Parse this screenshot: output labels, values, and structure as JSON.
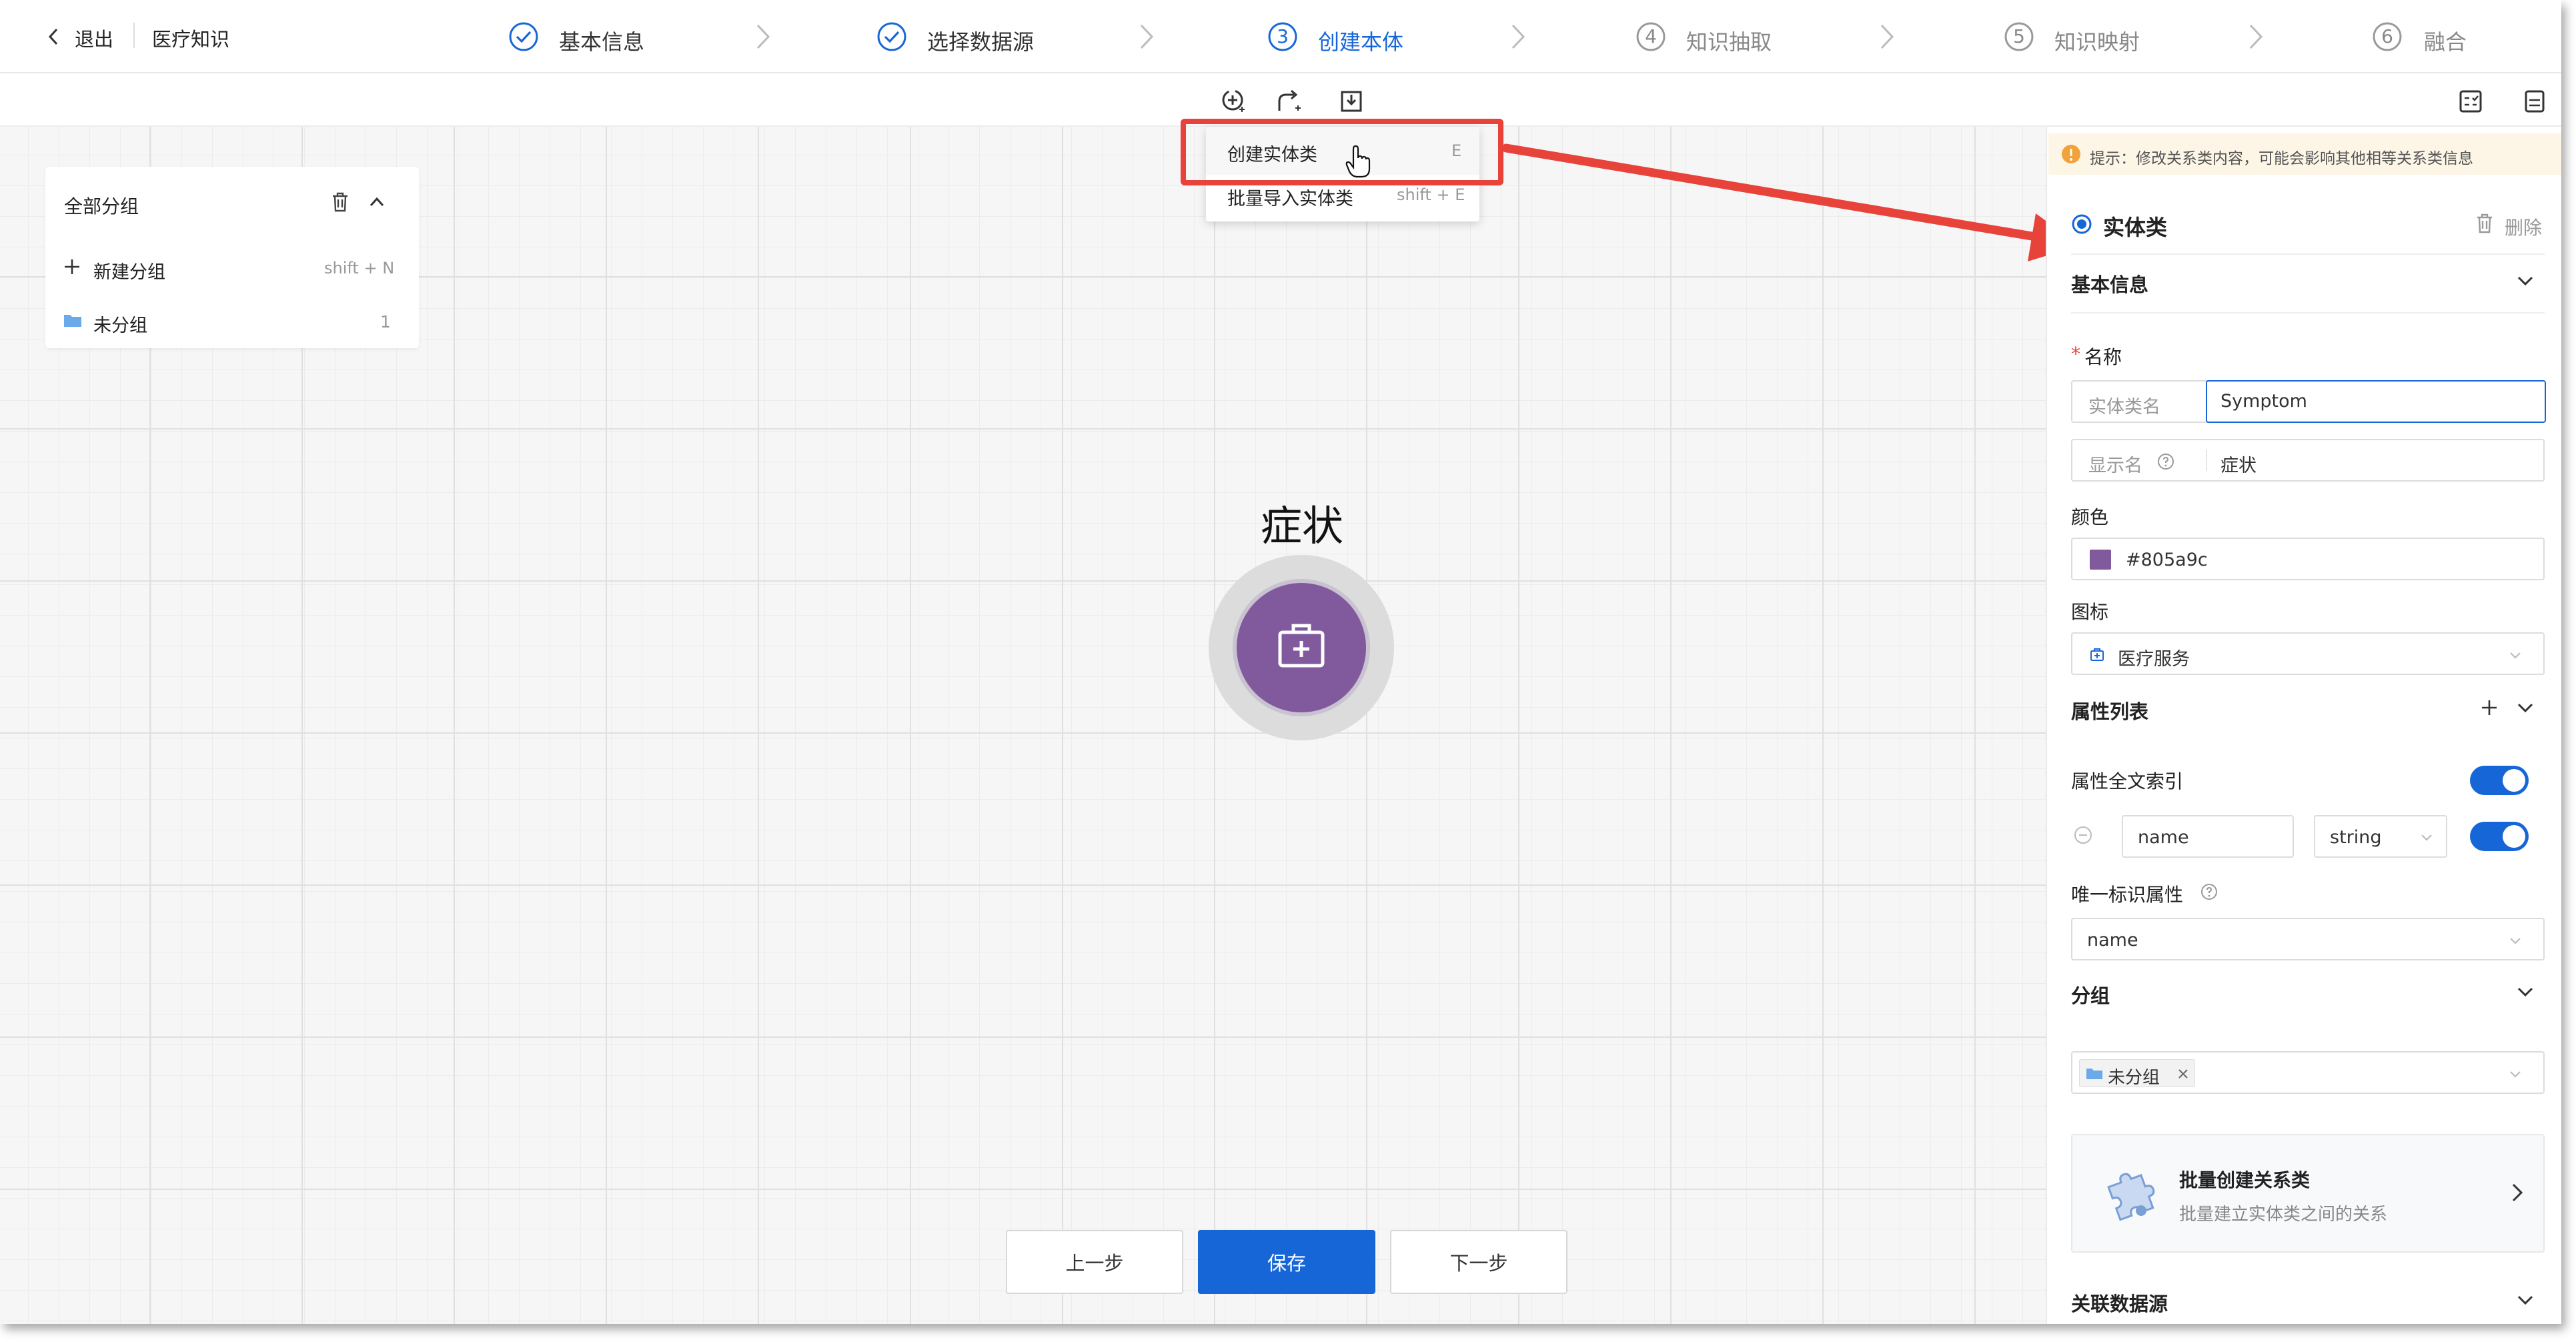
{
  "header": {
    "back_label": "退出",
    "project_name": "医疗知识"
  },
  "steps": [
    {
      "index": "",
      "label": "基本信息",
      "state": "done"
    },
    {
      "index": "",
      "label": "选择数据源",
      "state": "done"
    },
    {
      "index": "3",
      "label": "创建本体",
      "state": "active"
    },
    {
      "index": "4",
      "label": "知识抽取",
      "state": "pending"
    },
    {
      "index": "5",
      "label": "知识映射",
      "state": "pending"
    },
    {
      "index": "6",
      "label": "融合",
      "state": "pending"
    }
  ],
  "toolbar": {
    "icons": [
      "add-entity-icon",
      "add-relation-icon",
      "import-icon",
      "schema-icon",
      "notes-icon"
    ]
  },
  "dropdown_menu": {
    "items": [
      {
        "label": "创建实体类",
        "shortcut": "E"
      },
      {
        "label": "批量导入实体类",
        "shortcut": "shift + E"
      }
    ]
  },
  "groups_panel": {
    "title": "全部分组",
    "new_group_label": "新建分组",
    "new_group_shortcut": "shift + N",
    "groups": [
      {
        "name": "未分组",
        "count": "1"
      }
    ]
  },
  "canvas": {
    "node_label": "症状",
    "node_color": "#805a9c"
  },
  "footer": {
    "prev_label": "上一步",
    "save_label": "保存",
    "next_label": "下一步"
  },
  "right_panel": {
    "tip": "提示：修改关系类内容，可能会影响其他相等关系类信息",
    "title": "实体类",
    "delete_label": "删除",
    "basic_info_label": "基本信息",
    "name_label": "名称",
    "entity_name_hint": "实体类名",
    "entity_name_value": "Symptom",
    "display_name_hint": "显示名",
    "display_name_value": "症状",
    "color_label": "颜色",
    "color_value": "#805a9c",
    "icon_label": "图标",
    "icon_value": "医疗服务",
    "attr_list_label": "属性列表",
    "fulltext_label": "属性全文索引",
    "attr_name_value": "name",
    "attr_type_value": "string",
    "unique_attr_label": "唯一标识属性",
    "unique_attr_value": "name",
    "group_label": "分组",
    "group_tag": "未分组",
    "batch_title": "批量创建关系类",
    "batch_desc": "批量建立实体类之间的关系",
    "linked_source_label": "关联数据源"
  },
  "colors": {
    "accent": "#1666d8",
    "callout_red": "#e8433a",
    "node_purple": "#805a9c",
    "tip_bg": "#fdf6e7",
    "tip_icon": "#f2a23a"
  }
}
